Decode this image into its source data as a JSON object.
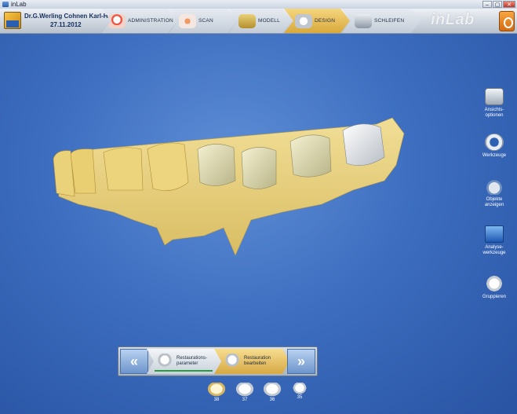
{
  "window": {
    "title": "inLab",
    "controls": [
      "–",
      "▢",
      "✕"
    ]
  },
  "patient": {
    "name": "Dr.G.Werling Cohnen Karl-He...",
    "date": "27.11.2012"
  },
  "steps": [
    {
      "label": "ADMINISTRATION",
      "icon": "admin-icon"
    },
    {
      "label": "SCAN",
      "icon": "scan-icon"
    },
    {
      "label": "MODELL",
      "icon": "model-icon"
    },
    {
      "label": "DESIGN",
      "icon": "design-icon",
      "active": true
    },
    {
      "label": "SCHLEIFEN",
      "icon": "milling-icon"
    }
  ],
  "logo": "inLab",
  "tools": [
    {
      "label": "Ansichts-\noptionen",
      "icon": "view-options-icon"
    },
    {
      "label": "Werkzeuge",
      "icon": "tools-icon"
    },
    {
      "label": "Objekte\nanzeigen",
      "icon": "show-objects-icon"
    },
    {
      "label": "Analyse-\nwerkzeuge",
      "icon": "analysis-tools-icon"
    },
    {
      "label": "Gruppieren",
      "icon": "group-icon"
    }
  ],
  "phase_panel": {
    "prev": "«",
    "next": "»",
    "items": [
      {
        "label": "Restaurations-\nparameter",
        "icon": "restoration-parameter-icon"
      },
      {
        "label": "Restauration\nbearbeiten",
        "icon": "edit-restoration-icon",
        "active": true
      }
    ]
  },
  "teeth": [
    {
      "number": "38",
      "active": true
    },
    {
      "number": "37"
    },
    {
      "number": "36"
    },
    {
      "number": "35"
    }
  ],
  "colors": {
    "background": "#3d6ec0",
    "model": "#e6cf7e",
    "active_step": "#e8c35a"
  }
}
